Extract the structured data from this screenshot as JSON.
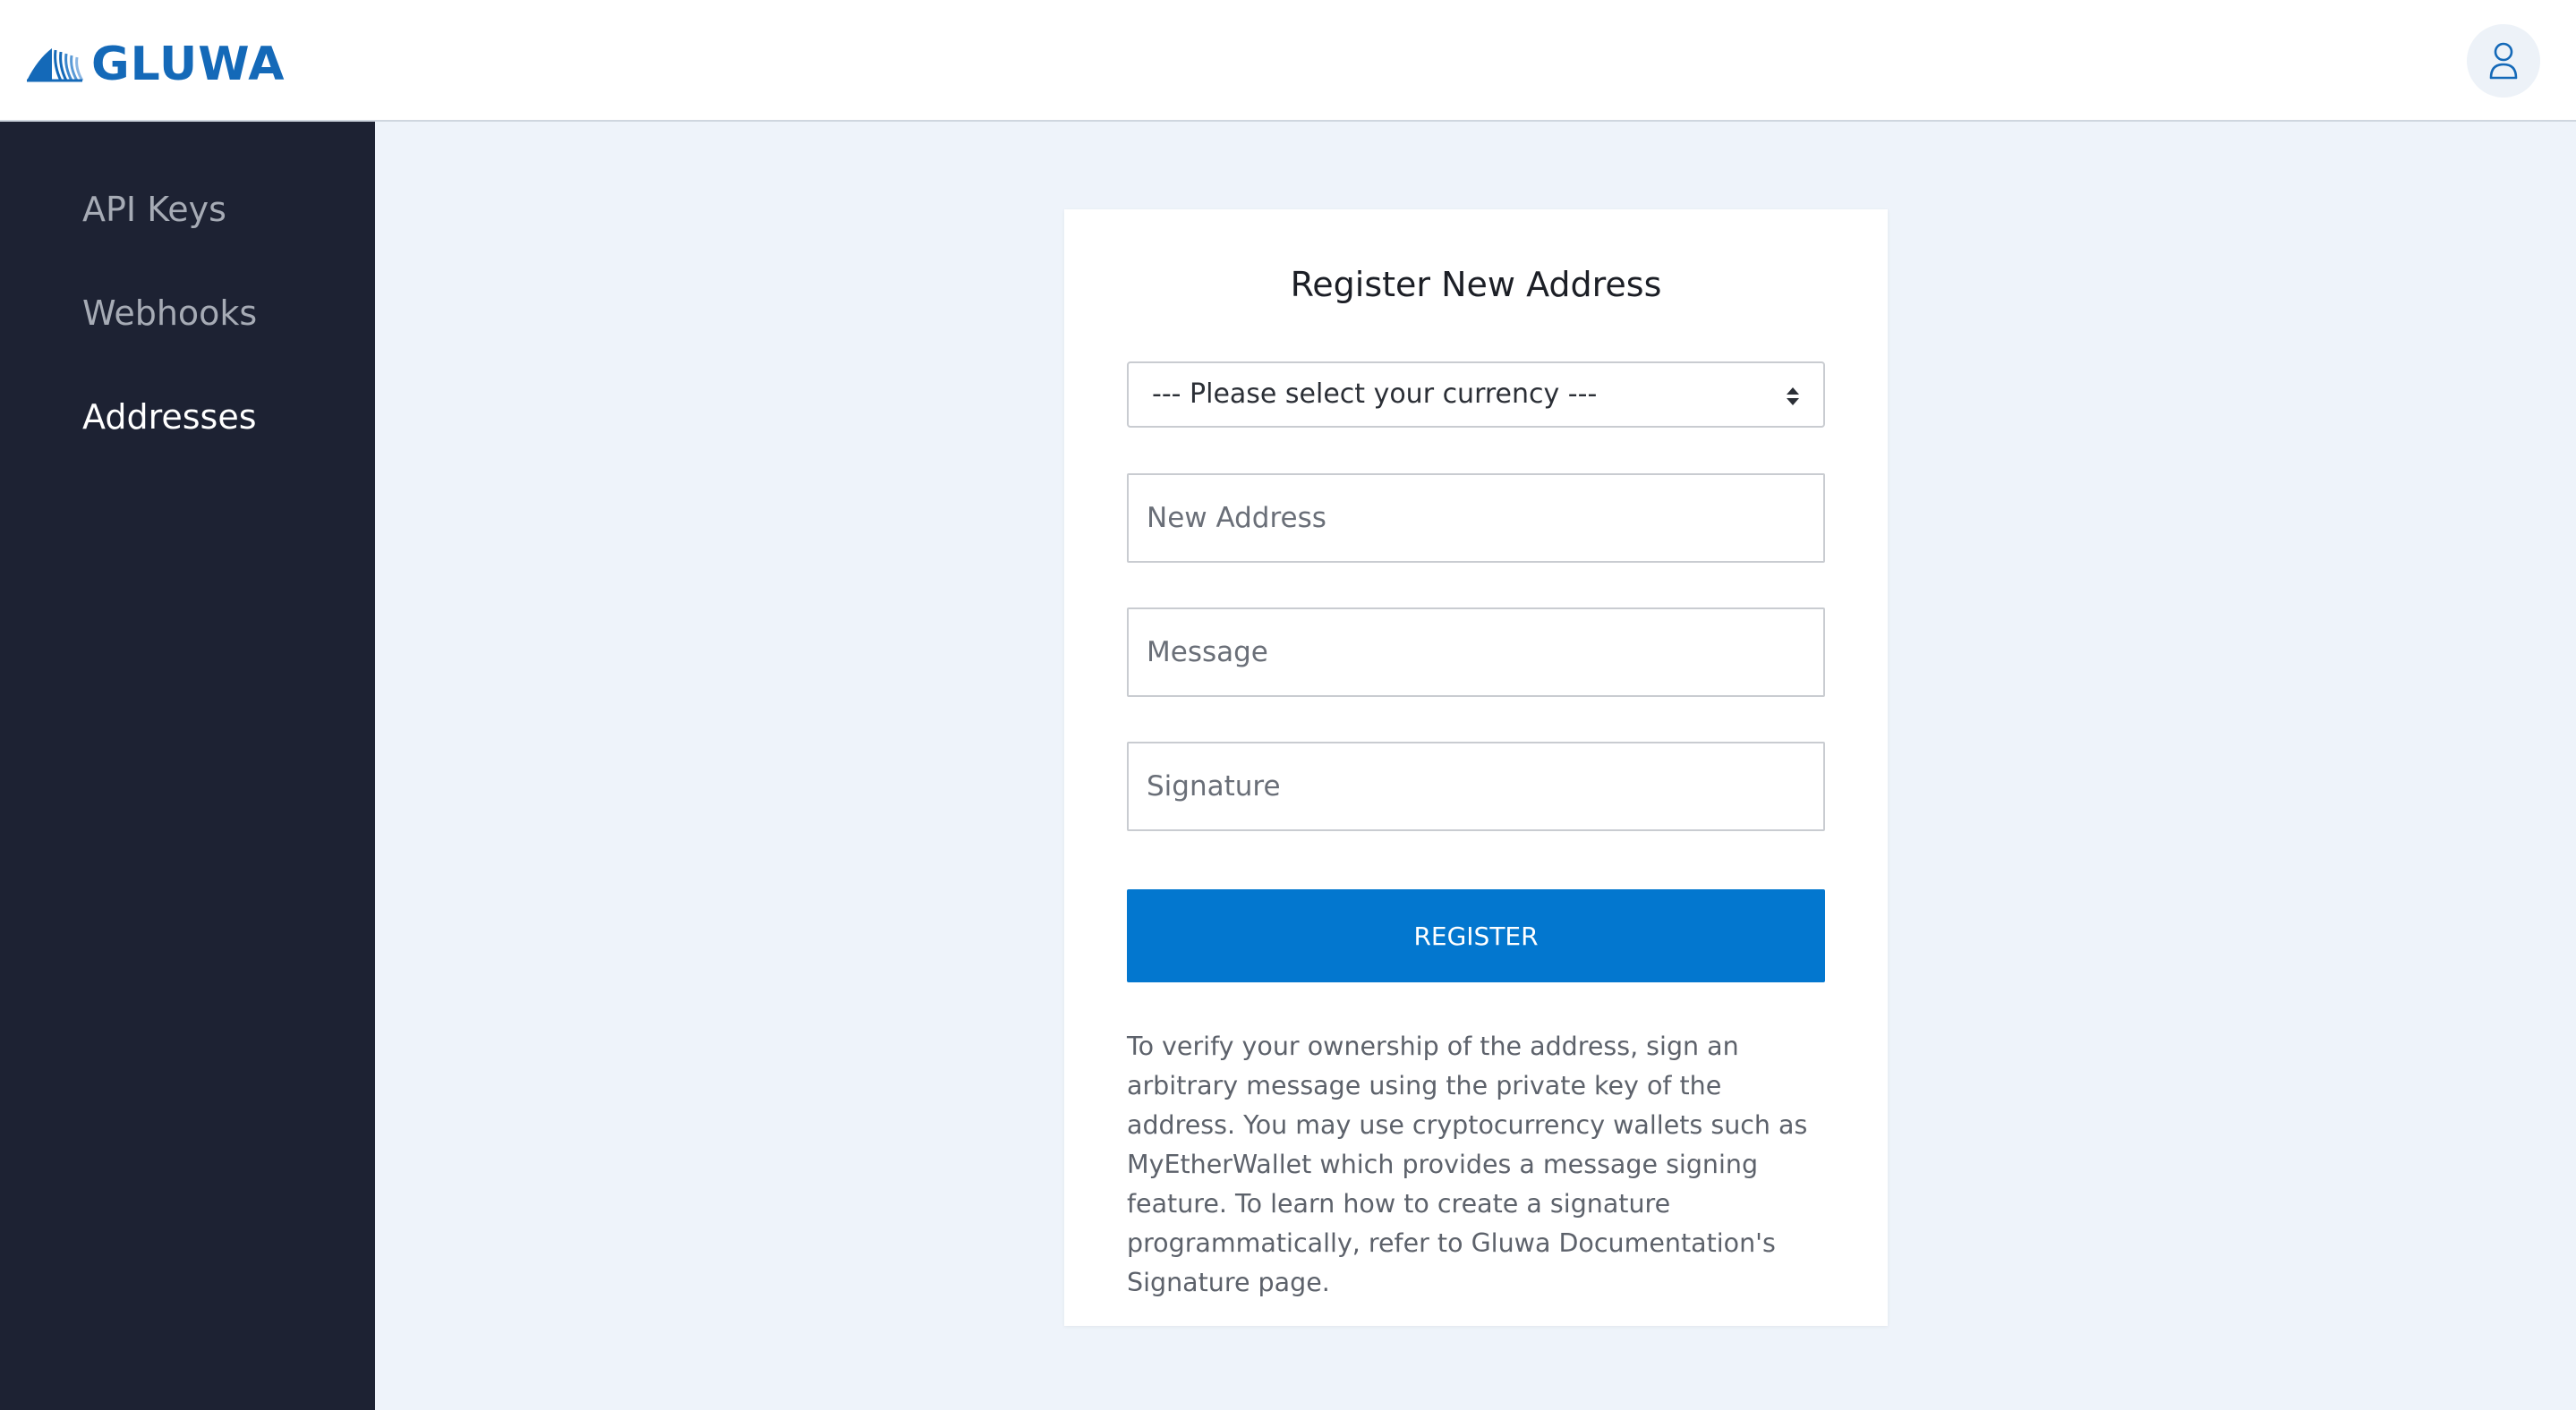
{
  "header": {
    "logo_text": "GLUWA",
    "logo_icon": "gluwa-wave-icon",
    "user_icon": "user-icon",
    "brand_color": "#1469b8"
  },
  "sidebar": {
    "background": "#1d2233",
    "items": [
      {
        "label": "API Keys",
        "active": false
      },
      {
        "label": "Webhooks",
        "active": false
      },
      {
        "label": "Addresses",
        "active": true
      }
    ]
  },
  "form": {
    "title": "Register New Address",
    "currency_select": {
      "selected": "--- Please select your currency ---"
    },
    "fields": {
      "new_address": {
        "placeholder": "New Address",
        "value": ""
      },
      "message": {
        "placeholder": "Message",
        "value": ""
      },
      "signature": {
        "placeholder": "Signature",
        "value": ""
      }
    },
    "submit_label": "REGISTER",
    "submit_color": "#0377cf",
    "help_text": "To verify your ownership of the address, sign an arbitrary message using the private key of the address. You may use cryptocurrency wallets such as MyEtherWallet which provides a message signing feature. To learn how to create a signature programmatically, refer to Gluwa Documentation's Signature page."
  }
}
